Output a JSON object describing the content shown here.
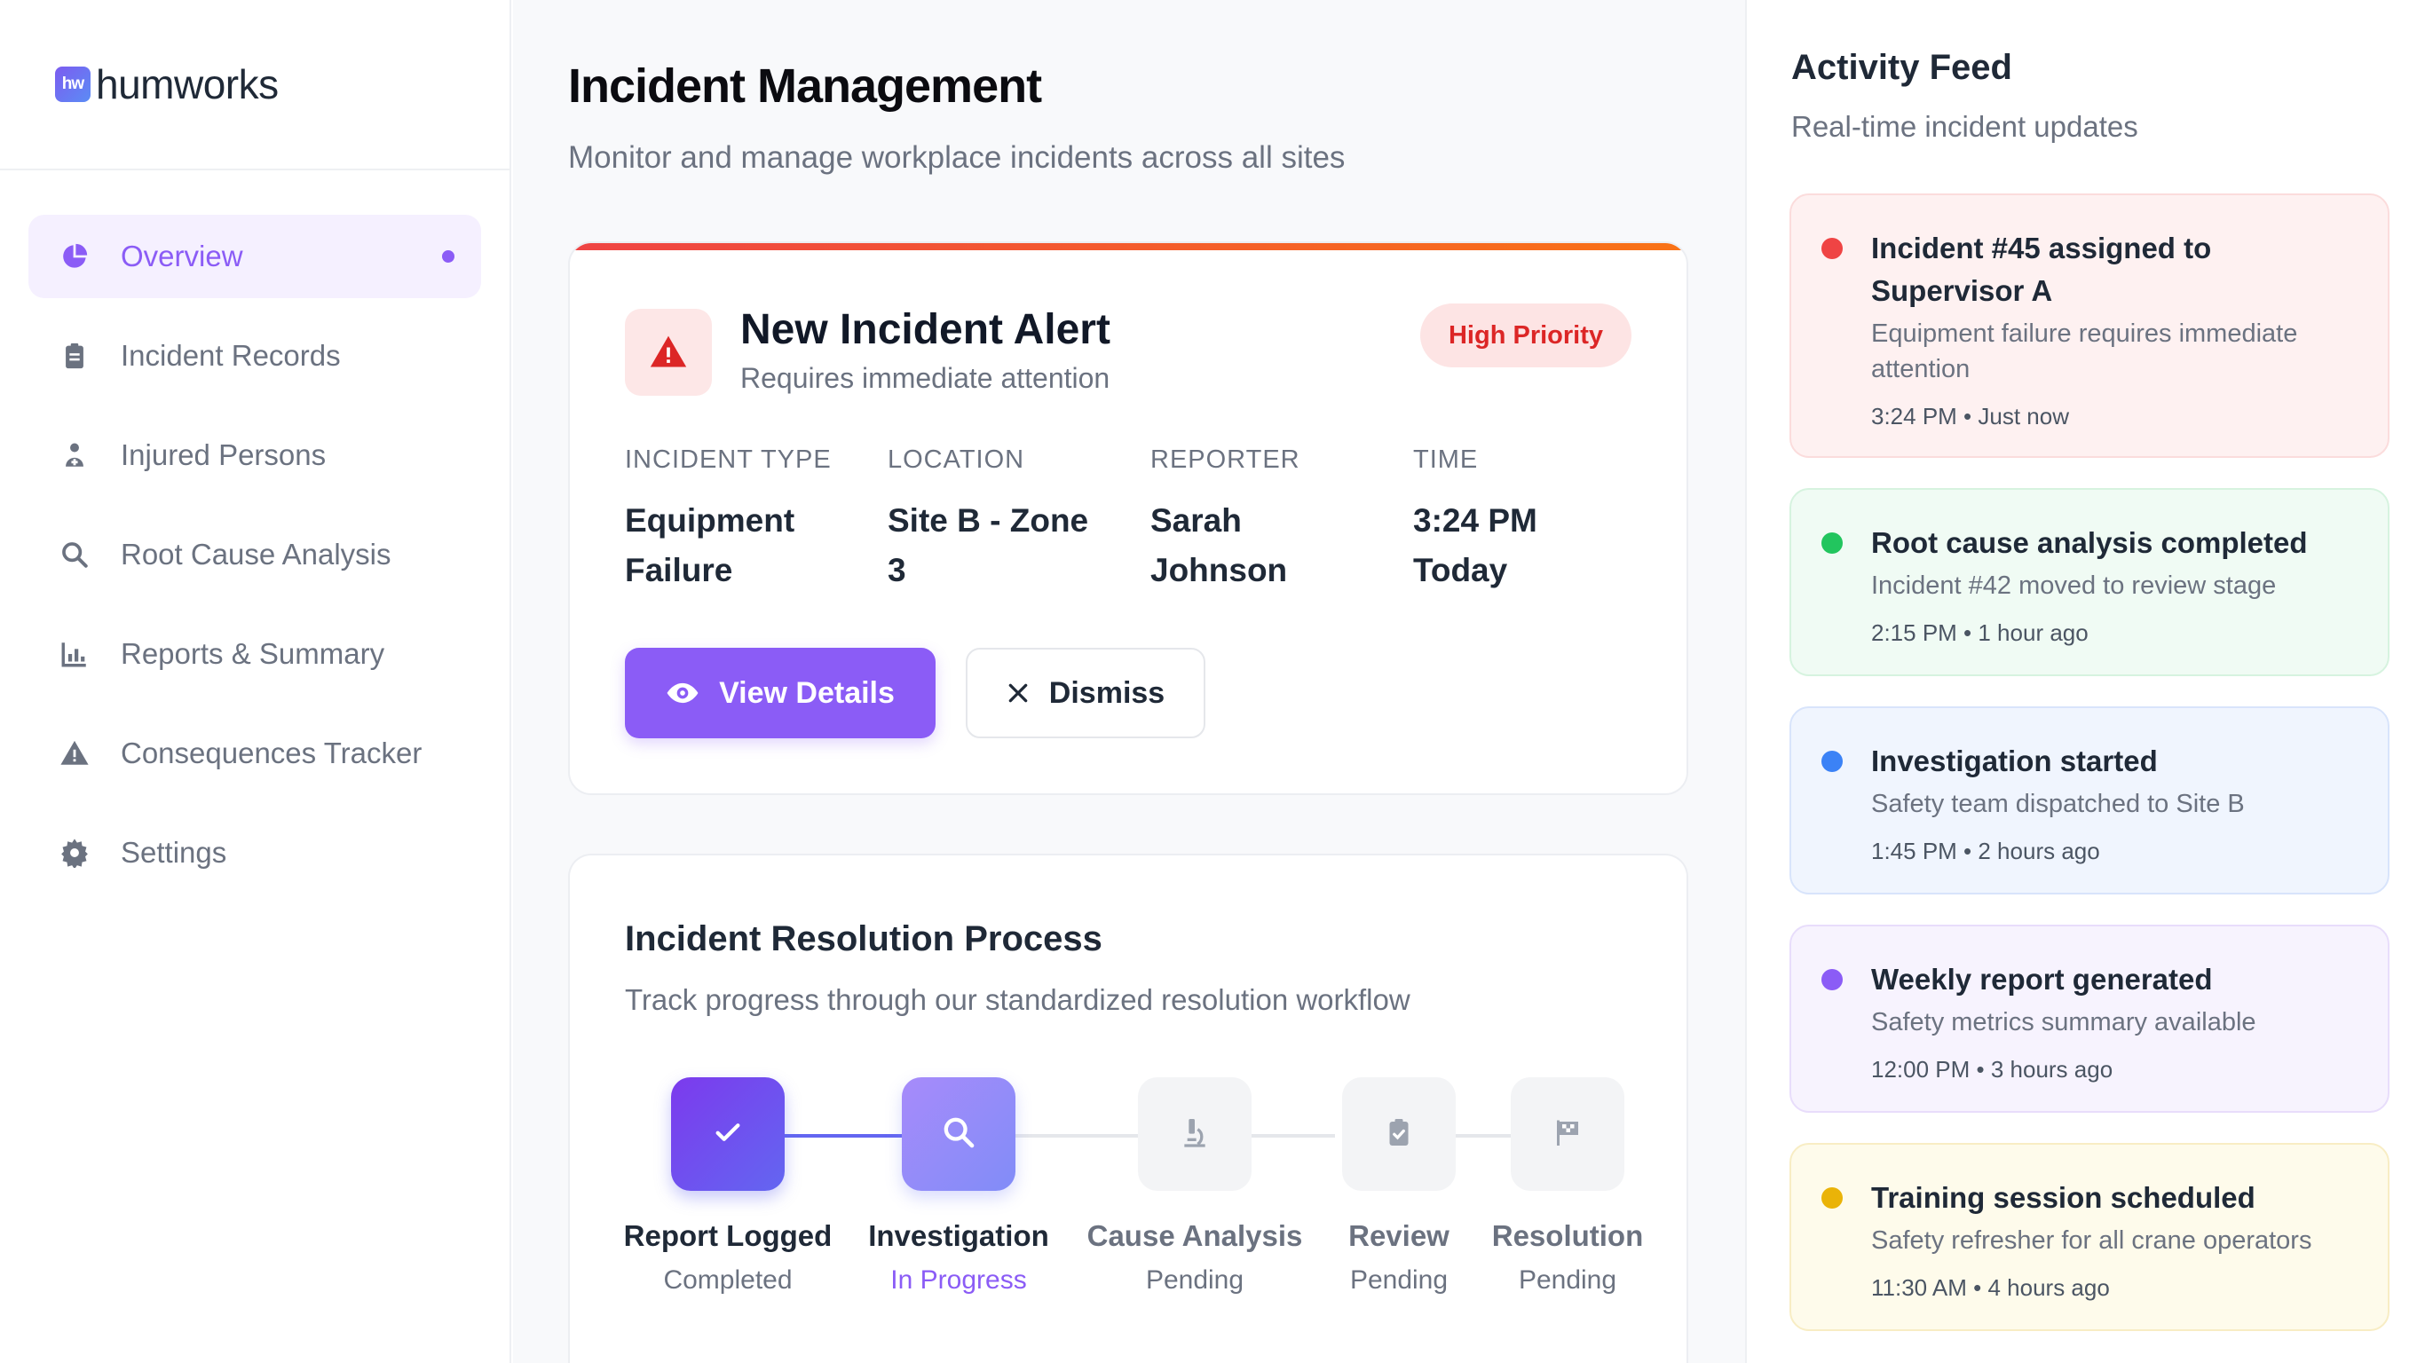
{
  "brand": {
    "logo_mark": "hw",
    "name": "humworks"
  },
  "sidebar": {
    "items": [
      {
        "label": "Overview",
        "icon": "pie-chart-icon",
        "active": true
      },
      {
        "label": "Incident Records",
        "icon": "clipboard-icon"
      },
      {
        "label": "Injured Persons",
        "icon": "injured-person-icon"
      },
      {
        "label": "Root Cause Analysis",
        "icon": "search-icon"
      },
      {
        "label": "Reports & Summary",
        "icon": "bar-chart-icon"
      },
      {
        "label": "Consequences Tracker",
        "icon": "warning-icon"
      },
      {
        "label": "Settings",
        "icon": "gear-icon"
      }
    ]
  },
  "header": {
    "title": "Incident Management",
    "subtitle": "Monitor and manage workplace incidents across all sites"
  },
  "alert": {
    "title": "New Incident Alert",
    "subtitle": "Requires immediate attention",
    "priority": "High Priority",
    "fields": [
      {
        "label": "INCIDENT TYPE",
        "value": "Equipment Failure"
      },
      {
        "label": "LOCATION",
        "value": "Site B - Zone 3"
      },
      {
        "label": "REPORTER",
        "value": "Sarah Johnson"
      },
      {
        "label": "TIME",
        "value": "3:24 PM Today"
      }
    ],
    "view_label": "View Details",
    "dismiss_label": "Dismiss"
  },
  "process": {
    "title": "Incident Resolution Process",
    "subtitle": "Track progress through our standardized resolution workflow",
    "steps": [
      {
        "label": "Report Logged",
        "status": "Completed",
        "icon": "check-icon"
      },
      {
        "label": "Investigation",
        "status": "In Progress",
        "icon": "search-icon"
      },
      {
        "label": "Cause Analysis",
        "status": "Pending",
        "icon": "microscope-icon"
      },
      {
        "label": "Review",
        "status": "Pending",
        "icon": "clipboard-check-icon"
      },
      {
        "label": "Resolution",
        "status": "Pending",
        "icon": "flag-icon"
      }
    ]
  },
  "feed": {
    "title": "Activity Feed",
    "subtitle": "Real-time incident updates",
    "items": [
      {
        "title": "Incident #45 assigned to Supervisor A",
        "text": "Equipment failure requires immediate attention",
        "meta": "3:24 PM • Just now",
        "color": "#ef4444",
        "bg": "#fef1f1",
        "border": "#fbdcdc"
      },
      {
        "title": "Root cause analysis completed",
        "text": "Incident #42 moved to review stage",
        "meta": "2:15 PM • 1 hour ago",
        "color": "#22c55e",
        "bg": "#f0fbf4",
        "border": "#d6f3df"
      },
      {
        "title": "Investigation started",
        "text": "Safety team dispatched to Site B",
        "meta": "1:45 PM • 2 hours ago",
        "color": "#3b82f6",
        "bg": "#f0f5fe",
        "border": "#d8e4fb"
      },
      {
        "title": "Weekly report generated",
        "text": "Safety metrics summary available",
        "meta": "12:00 PM • 3 hours ago",
        "color": "#8b5cf6",
        "bg": "#f7f3fe",
        "border": "#e8ddfb"
      },
      {
        "title": "Training session scheduled",
        "text": "Safety refresher for all crane operators",
        "meta": "11:30 AM • 4 hours ago",
        "color": "#eab308",
        "bg": "#fefbeb",
        "border": "#f8edc4"
      }
    ]
  }
}
